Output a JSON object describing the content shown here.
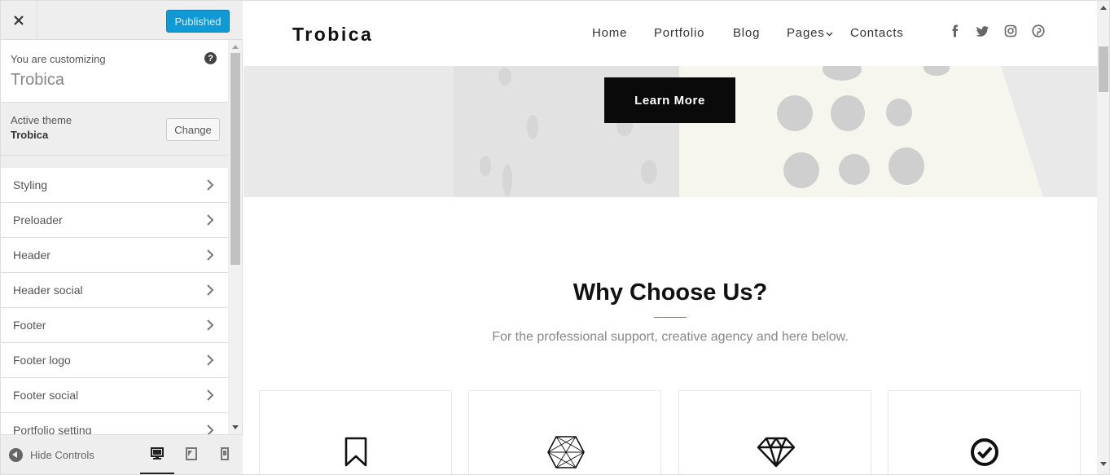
{
  "customizer": {
    "close_icon": "close-icon",
    "publish_label": "Published",
    "customizing_label": "You are customizing",
    "site_name": "Trobica",
    "help_icon": "?",
    "active_theme_label": "Active theme",
    "active_theme_name": "Trobica",
    "change_label": "Change",
    "menu": [
      {
        "label": "Styling"
      },
      {
        "label": "Preloader"
      },
      {
        "label": "Header"
      },
      {
        "label": "Header social"
      },
      {
        "label": "Footer"
      },
      {
        "label": "Footer logo"
      },
      {
        "label": "Footer social"
      },
      {
        "label": "Portfolio setting"
      }
    ],
    "hide_controls_label": "Hide Controls",
    "devices": [
      "desktop-icon",
      "tablet-icon",
      "mobile-icon"
    ],
    "selected_device": "desktop"
  },
  "site": {
    "logo": "Trobica",
    "nav": [
      "Home",
      "Portfolio",
      "Blog",
      "Pages",
      "Contacts"
    ],
    "social_icons": [
      "facebook-icon",
      "twitter-icon",
      "instagram-icon",
      "pinterest-icon"
    ],
    "hero_button": "Learn More",
    "section_title": "Why Choose Us?",
    "section_subtitle": "For the professional support, creative agency and here below.",
    "feature_icons": [
      "bookmark-icon",
      "hexagon-icon",
      "diamond-icon",
      "check-circle-icon"
    ],
    "accent_color": "#e04b6b",
    "publish_color": "#0f9ad5"
  }
}
